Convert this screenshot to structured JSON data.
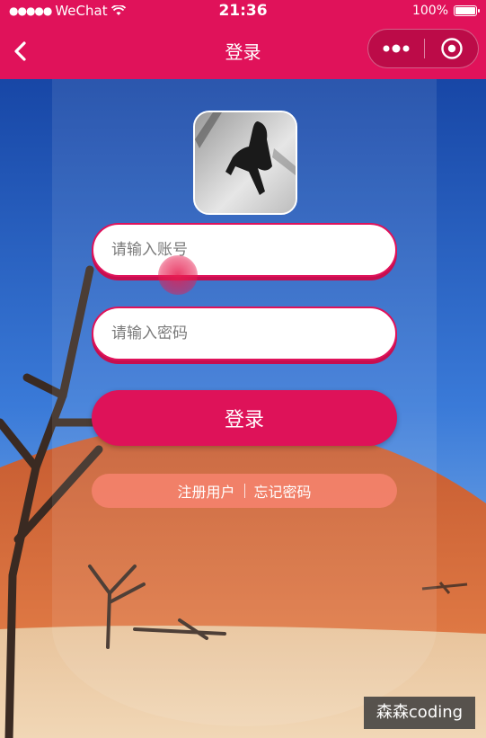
{
  "status_bar": {
    "carrier": "WeChat",
    "signal_dots": "●●●●●",
    "time": "21:36",
    "battery": "100%"
  },
  "nav": {
    "title": "登录",
    "back_icon": "chevron-left-icon",
    "more_icon": "more-dots-icon",
    "close_icon": "target-circle-icon"
  },
  "form": {
    "account_placeholder": "请输入账号",
    "password_placeholder": "请输入密码",
    "login_label": "登录",
    "register_label": "注册用户",
    "forgot_label": "忘记密码"
  },
  "watermark": "森森coding",
  "colors": {
    "brand": "#e0125a",
    "links_bar": "#f7826e",
    "sky": "#1b4aa8",
    "dune": "#d9693a",
    "sand": "#e9c9a3"
  }
}
